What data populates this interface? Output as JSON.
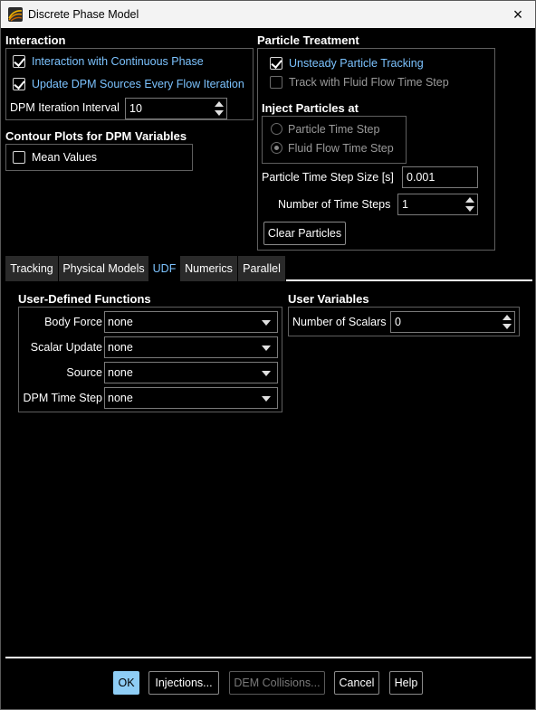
{
  "window": {
    "title": "Discrete Phase Model",
    "close_icon": "×"
  },
  "interaction": {
    "title": "Interaction",
    "continuous_phase_label": "Interaction with Continuous Phase",
    "continuous_phase_checked": true,
    "update_sources_label": "Update DPM Sources Every Flow Iteration",
    "update_sources_checked": true,
    "iteration_interval_label": "DPM Iteration Interval",
    "iteration_interval_value": "10"
  },
  "contour": {
    "title": "Contour Plots for DPM Variables",
    "mean_values_label": "Mean Values",
    "mean_values_checked": false
  },
  "particle_treatment": {
    "title": "Particle Treatment",
    "unsteady_label": "Unsteady Particle Tracking",
    "unsteady_checked": true,
    "track_fluid_label": "Track with Fluid Flow Time Step",
    "track_fluid_checked": false,
    "inject_title": "Inject Particles at",
    "particle_time_step_label": "Particle Time Step",
    "fluid_flow_time_step_label": "Fluid Flow Time Step",
    "selected_inject": "fluid_flow_time_step",
    "time_step_size_label": "Particle Time Step Size [s]",
    "time_step_size_value": "0.001",
    "num_time_steps_label": "Number of Time Steps",
    "num_time_steps_value": "1",
    "clear_button": "Clear Particles"
  },
  "tabs": [
    {
      "label": "Tracking",
      "active": false
    },
    {
      "label": "Physical Models",
      "active": false
    },
    {
      "label": "UDF",
      "active": true
    },
    {
      "label": "Numerics",
      "active": false
    },
    {
      "label": "Parallel",
      "active": false
    }
  ],
  "udf": {
    "title": "User-Defined Functions",
    "rows": [
      {
        "label": "Body Force",
        "value": "none"
      },
      {
        "label": "Scalar Update",
        "value": "none"
      },
      {
        "label": "Source",
        "value": "none"
      },
      {
        "label": "DPM Time Step",
        "value": "none"
      }
    ]
  },
  "user_variables": {
    "title": "User Variables",
    "num_scalars_label": "Number of Scalars",
    "num_scalars_value": "0"
  },
  "footer": {
    "ok": "OK",
    "injections": "Injections...",
    "dem_collisions": "DEM Collisions...",
    "cancel": "Cancel",
    "help": "Help"
  },
  "colors": {
    "accent_blue_text": "#7cc3ff",
    "ok_button": "#8ecdf5",
    "background": "#000000"
  }
}
